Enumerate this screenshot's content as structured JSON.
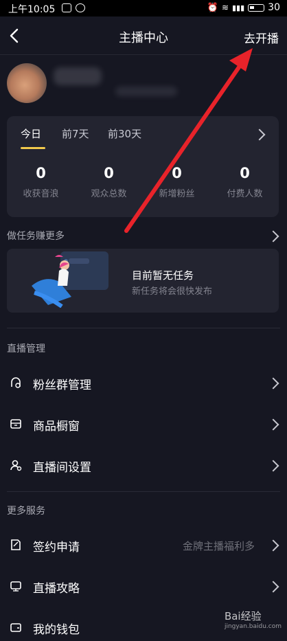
{
  "status_bar": {
    "time": "上午10:05",
    "battery": "30"
  },
  "header": {
    "title": "主播中心",
    "go_live": "去开播"
  },
  "stats": {
    "tabs": [
      "今日",
      "前7天",
      "前30天"
    ],
    "items": [
      {
        "value": "0",
        "label": "收获音浪"
      },
      {
        "value": "0",
        "label": "观众总数"
      },
      {
        "value": "0",
        "label": "新增粉丝"
      },
      {
        "value": "0",
        "label": "付费人数"
      }
    ]
  },
  "tasks": {
    "heading": "做任务赚更多",
    "empty_title": "目前暂无任务",
    "empty_subtitle": "新任务将会很快发布"
  },
  "live_management": {
    "heading": "直播管理",
    "items": [
      {
        "label": "粉丝群管理",
        "icon": "fan-group-icon"
      },
      {
        "label": "商品橱窗",
        "icon": "shop-window-icon"
      },
      {
        "label": "直播间设置",
        "icon": "room-settings-icon"
      }
    ]
  },
  "more_services": {
    "heading": "更多服务",
    "items": [
      {
        "label": "签约申请",
        "icon": "contract-icon",
        "hint": "金牌主播福利多"
      },
      {
        "label": "直播攻略",
        "icon": "guide-icon"
      },
      {
        "label": "我的钱包",
        "icon": "wallet-icon"
      }
    ]
  },
  "watermark": {
    "text": "Bai经验",
    "url": "jingyan.baidu.com"
  },
  "colors": {
    "background": "#161722",
    "card": "#232430",
    "accent_tab": "#f2c94c",
    "arrow": "#e8232a"
  }
}
